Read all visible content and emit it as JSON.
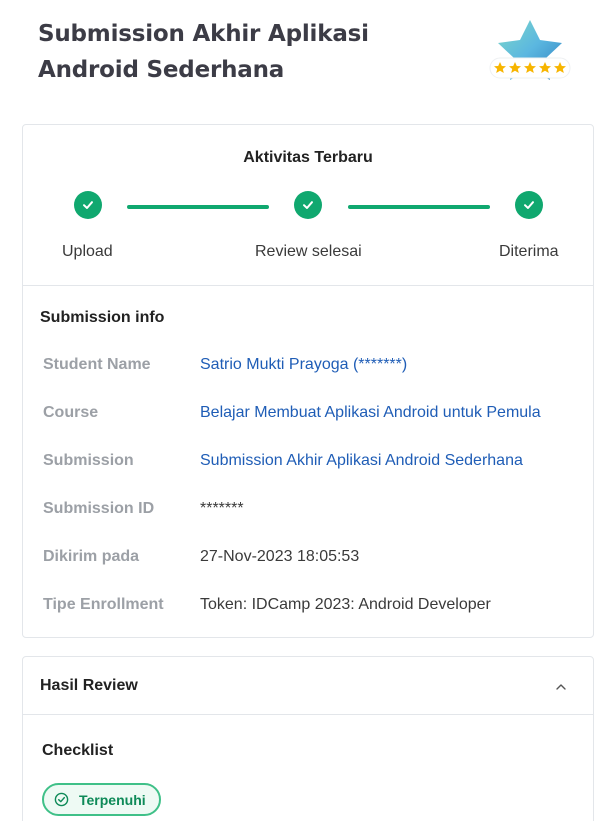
{
  "page": {
    "title": "Submission Akhir Aplikasi Android Sederhana"
  },
  "activity": {
    "title": "Aktivitas Terbaru",
    "steps": [
      {
        "label": "Upload",
        "done": true
      },
      {
        "label": "Review selesai",
        "done": true
      },
      {
        "label": "Diterima",
        "done": true
      }
    ],
    "accent_color": "#10a86f"
  },
  "submission_info": {
    "title": "Submission info",
    "rows": [
      {
        "key": "Student Name",
        "value": "Satrio Mukti Prayoga (*******)"
      },
      {
        "key": "Course",
        "value": "Belajar Membuat Aplikasi Android untuk Pemula"
      },
      {
        "key": "Submission",
        "value": "Submission Akhir Aplikasi Android Sederhana"
      },
      {
        "key": "Submission ID",
        "value": "*******"
      },
      {
        "key": "Dikirim pada",
        "value": "27-Nov-2023 18:05:53"
      },
      {
        "key": "Tipe Enrollment",
        "value": "Token: IDCamp 2023: Android Developer"
      }
    ]
  },
  "review": {
    "title": "Hasil Review",
    "checklist_title": "Checklist",
    "status": "Terpenuhi"
  },
  "rating": {
    "stars": 5,
    "icon": "star-rating-badge-icon"
  }
}
